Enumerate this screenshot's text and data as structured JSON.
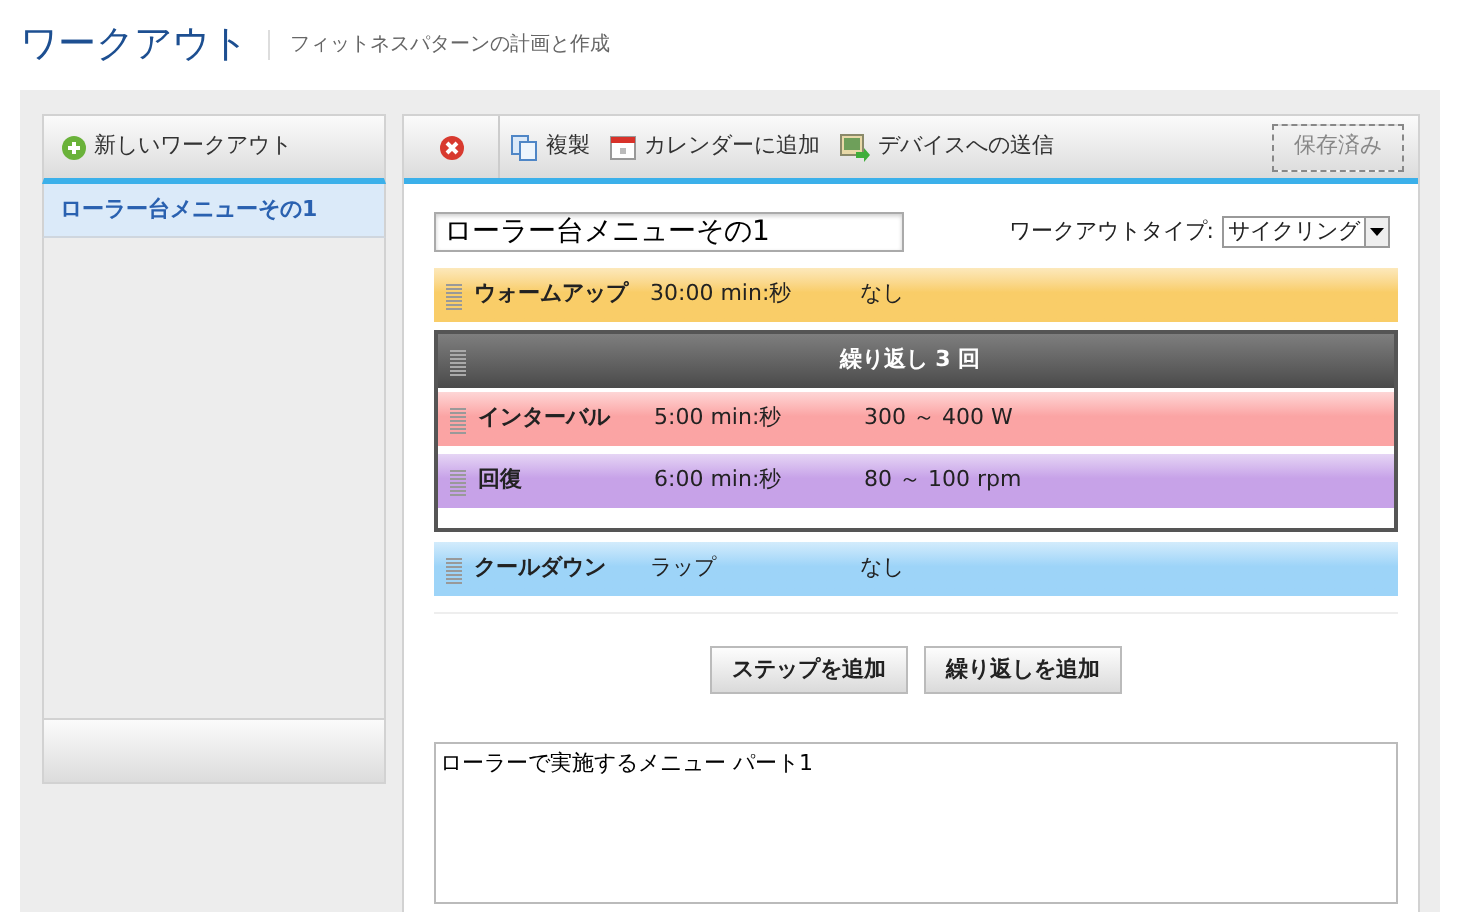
{
  "header": {
    "title": "ワークアウト",
    "subtitle": "フィットネスパターンの計画と作成"
  },
  "sidebar": {
    "new_button": "新しいワークアウト",
    "items": [
      {
        "label": "ローラー台メニューその1",
        "selected": true
      }
    ]
  },
  "toolbar": {
    "actions": [
      {
        "kind": "copy",
        "label": "複製"
      },
      {
        "kind": "calendar",
        "label": "カレンダーに追加"
      },
      {
        "kind": "device",
        "label": "デバイスへの送信"
      }
    ],
    "save_button": {
      "label": "保存済み",
      "disabled": true
    }
  },
  "workout": {
    "name": "ローラー台メニューその1",
    "type_label": "ワークアウトタイプ:",
    "type_value": "サイクリング",
    "steps": [
      {
        "kind": "step",
        "name": "ウォームアップ",
        "duration": "30:00 min:秒",
        "target": "なし",
        "color": "#f9cd68"
      },
      {
        "kind": "repeat",
        "label": "繰り返し 3 回",
        "children": [
          {
            "kind": "step",
            "name": "インターバル",
            "duration": "5:00 min:秒",
            "target": "300 ～ 400 W",
            "color": "#fba4a4"
          },
          {
            "kind": "step",
            "name": "回復",
            "duration": "6:00 min:秒",
            "target": "80 ～ 100 rpm",
            "color": "#c7a2e8"
          }
        ]
      },
      {
        "kind": "step",
        "name": "クールダウン",
        "duration": "ラップ",
        "target": "なし",
        "color": "#9dd4f8"
      }
    ],
    "buttons": [
      "ステップを追加",
      "繰り返しを追加"
    ],
    "notes": "ローラーで実施するメニュー パート1"
  }
}
